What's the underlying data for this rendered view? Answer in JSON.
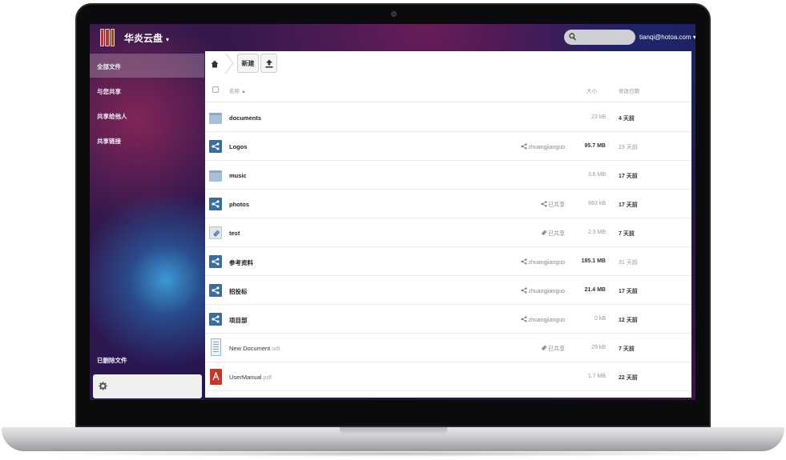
{
  "app": {
    "title": "华炎云盘",
    "caret": "▾"
  },
  "header": {
    "search_placeholder": "",
    "user": "tianqi@hotoa.com ▾"
  },
  "sidebar": {
    "items": [
      {
        "label": "全部文件",
        "active": true
      },
      {
        "label": "与您共享"
      },
      {
        "label": "共享给他人"
      },
      {
        "label": "共享链接"
      }
    ],
    "trash_label": "已删除文件",
    "settings_icon": "gear-icon"
  },
  "toolbar": {
    "home_icon": "home-icon",
    "new_label": "新建",
    "upload_icon": "upload-icon"
  },
  "table": {
    "headers": {
      "name": "名称 ▲",
      "size": "大小",
      "date": "修改日期"
    },
    "rows": [
      {
        "name": "documents",
        "ext": "",
        "icon": "folder",
        "share": "",
        "size": "23 kB",
        "date": "4 天前"
      },
      {
        "name": "Logos",
        "ext": "",
        "icon": "shared-folder",
        "share": "zhuangjianguo",
        "size": "95.7 MB",
        "date": "23 天前"
      },
      {
        "name": "music",
        "ext": "",
        "icon": "folder",
        "share": "",
        "size": "3.6 MB",
        "date": "17 天前"
      },
      {
        "name": "photos",
        "ext": "",
        "icon": "shared-folder",
        "share": "已共享",
        "size": "663 kB",
        "date": "17 天前"
      },
      {
        "name": "test",
        "ext": "",
        "icon": "link-folder",
        "share": "已共享",
        "size": "2.3 MB",
        "date": "7 天前"
      },
      {
        "name": "参考资料",
        "ext": "",
        "icon": "shared-folder",
        "share": "zhuangjianguo",
        "size": "185.1 MB",
        "date": "31 天前"
      },
      {
        "name": "招投标",
        "ext": "",
        "icon": "shared-folder",
        "share": "zhuangjianguo",
        "size": "21.4 MB",
        "date": "17 天前"
      },
      {
        "name": "项目部",
        "ext": "",
        "icon": "shared-folder",
        "share": "zhuangjianguo",
        "size": "0 kB",
        "date": "12 天前"
      },
      {
        "name": "New Document",
        "ext": ".odt",
        "icon": "document",
        "share": "已共享",
        "size": "29 kB",
        "date": "7 天前"
      },
      {
        "name": "UserManual",
        "ext": ".pdf",
        "icon": "pdf",
        "share": "",
        "size": "1.7 MB",
        "date": "22 天前"
      }
    ]
  }
}
